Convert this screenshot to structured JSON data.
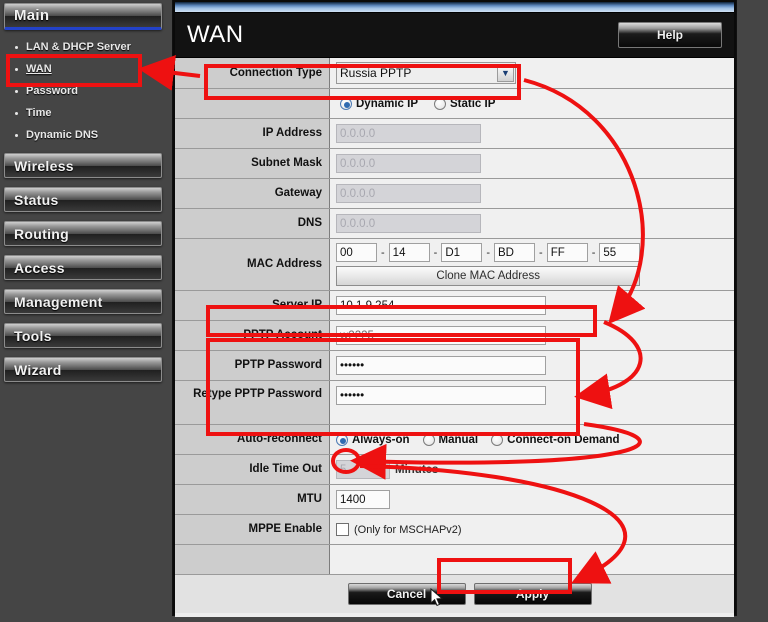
{
  "sidebar": {
    "sections": [
      {
        "label": "Main",
        "active": true,
        "items": [
          {
            "label": "LAN & DHCP Server",
            "current": false
          },
          {
            "label": "WAN",
            "current": true
          },
          {
            "label": "Password",
            "current": false
          },
          {
            "label": "Time",
            "current": false
          },
          {
            "label": "Dynamic DNS",
            "current": false
          }
        ]
      },
      {
        "label": "Wireless"
      },
      {
        "label": "Status"
      },
      {
        "label": "Routing"
      },
      {
        "label": "Access"
      },
      {
        "label": "Management"
      },
      {
        "label": "Tools"
      },
      {
        "label": "Wizard"
      }
    ]
  },
  "header": {
    "title": "WAN",
    "help_label": "Help"
  },
  "form": {
    "connection_type": {
      "label": "Connection Type",
      "value": "Russia PPTP",
      "options": [
        "Russia PPTP"
      ]
    },
    "ip_mode": {
      "dynamic_label": "Dynamic IP",
      "static_label": "Static IP",
      "selected": "Dynamic IP"
    },
    "ip_address": {
      "label": "IP Address",
      "value": "0.0.0.0",
      "disabled": true
    },
    "subnet_mask": {
      "label": "Subnet Mask",
      "value": "0.0.0.0",
      "disabled": true
    },
    "gateway": {
      "label": "Gateway",
      "value": "0.0.0.0",
      "disabled": true
    },
    "dns": {
      "label": "DNS",
      "value": "0.0.0.0",
      "disabled": true
    },
    "mac_address": {
      "label": "MAC Address",
      "octets": [
        "00",
        "14",
        "D1",
        "BD",
        "FF",
        "55"
      ],
      "separator": "-",
      "clone_label": "Clone MAC Address"
    },
    "server_ip": {
      "label": "Server IP",
      "value": "10.1.9.254"
    },
    "pptp_account": {
      "label": "PPTP Account",
      "value": "w2225"
    },
    "pptp_password": {
      "label": "PPTP Password",
      "value": "••••••"
    },
    "retype_pptp_password": {
      "label": "Retype PPTP Password",
      "value": "••••••"
    },
    "auto_reconnect": {
      "label": "Auto-reconnect",
      "options": [
        "Always-on",
        "Manual",
        "Connect-on Demand"
      ],
      "selected": "Always-on"
    },
    "idle_time_out": {
      "label": "Idle Time Out",
      "value": "5",
      "unit": "Minutes",
      "disabled": true
    },
    "mtu": {
      "label": "MTU",
      "value": "1400"
    },
    "mppe_enable": {
      "label": "MPPE Enable",
      "note": "(Only for MSCHAPv2)",
      "checked": false
    }
  },
  "buttons": {
    "cancel_label": "Cancel",
    "apply_label": "Apply"
  },
  "annotation": {
    "color": "#ee1111",
    "shapes": [
      "wan-menu-box",
      "connection-type-box",
      "server-ip-box",
      "pptp-credentials-box",
      "apply-button-box",
      "always-on-radio-circle"
    ]
  }
}
